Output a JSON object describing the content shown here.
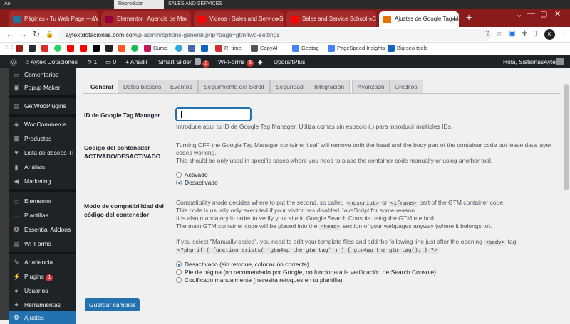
{
  "os_strip": {
    "left": "Ao",
    "middle": "Reproducir",
    "right": "SALES AND SERVICES"
  },
  "browser": {
    "tabs": [
      {
        "title": "Páginas ‹ Tu Web Page — W",
        "icon_color": "#21759b"
      },
      {
        "title": "Elementor | Agencia de Ma",
        "icon_color": "#92003b"
      },
      {
        "title": "Videos - Sales and Service S",
        "icon_color": "#ff0000"
      },
      {
        "title": "Sales and Service School - C",
        "icon_color": "#ff0000"
      },
      {
        "title": "Ajustes de Google Tag Mana",
        "icon_color": "#e37400",
        "active": true
      }
    ],
    "new_tab": "+",
    "window_controls": [
      "⌄",
      "—",
      "▢",
      "✕"
    ],
    "url_host": "aytextdotaciones.com.co",
    "url_path": "/wp-admin/options-general.php?page=gtm4wp-settings",
    "profile_initial": "K",
    "bookmarks": [
      {
        "label": "",
        "color": "#9e1c1c"
      },
      {
        "label": "",
        "color": "#2b2b2b"
      },
      {
        "label": "",
        "color": "#d93025"
      },
      {
        "label": "",
        "color": "#25d366"
      },
      {
        "label": "",
        "color": "#ff0000"
      },
      {
        "label": "",
        "color": "#ff0000"
      },
      {
        "label": "",
        "color": "#000000"
      },
      {
        "label": "",
        "color": "#222"
      },
      {
        "label": "",
        "color": "#ff5722"
      },
      {
        "label": "",
        "color": "#1db954"
      },
      {
        "label": "Curso",
        "color": "#c2185b"
      },
      {
        "label": "",
        "color": "#2ca5e0"
      },
      {
        "label": "",
        "color": "#4267b2"
      },
      {
        "label": "",
        "color": "#0a66c2"
      },
      {
        "label": "R. time",
        "color": "#d32f2f"
      },
      {
        "label": "CopyAI",
        "color": "#555"
      },
      {
        "label": "Geotag",
        "color": "#4285f4"
      },
      {
        "label": "PageSpeed Insights",
        "color": "#4285f4"
      },
      {
        "label": "Big seo tools",
        "color": "#1565c0"
      }
    ]
  },
  "adminbar": {
    "site_name": "Aytex Dotaciones",
    "updates": "1",
    "comments": "0",
    "add_new": "Añadir",
    "smart_slider": "Smart Slider",
    "yoast_count": "2",
    "wpforms_label": "WPForms",
    "wpforms_count": "5",
    "updraft": "UpdraftPlus",
    "greeting": "Hola, SistemasAytex"
  },
  "sidebar": {
    "items": [
      {
        "label": "Comentarios",
        "icon": "💬"
      },
      {
        "label": "Popup Maker",
        "icon": "▣"
      },
      {
        "label": "GetWooPlugins",
        "icon": "▤"
      },
      {
        "label": "WooCommerce",
        "icon": "◈"
      },
      {
        "label": "Productos",
        "icon": "▦"
      },
      {
        "label": "Lista de deseos TI",
        "icon": "♥"
      },
      {
        "label": "Análisis",
        "icon": "▮"
      },
      {
        "label": "Marketing",
        "icon": "📣"
      },
      {
        "label": "Elementor",
        "icon": "ⓔ"
      },
      {
        "label": "Plantillas",
        "icon": "▭"
      },
      {
        "label": "Essential Addons",
        "icon": "✪"
      },
      {
        "label": "WPForms",
        "icon": "▤"
      },
      {
        "label": "Apariencia",
        "icon": "✎"
      },
      {
        "label": "Plugins",
        "icon": "⚡",
        "badge": "1"
      },
      {
        "label": "Usuarios",
        "icon": "👤"
      },
      {
        "label": "Herramientas",
        "icon": "🔧"
      },
      {
        "label": "Ajustes",
        "icon": "⚙"
      }
    ]
  },
  "settings_tabs": [
    "General",
    "Datos básicos",
    "Eventos",
    "Seguimiento del Scroll",
    "Seguridad",
    "Integración",
    "Avanzado",
    "Créditos"
  ],
  "fields": {
    "gtm_id": {
      "label": "ID de Google Tag Manager",
      "value": "",
      "help": "Introduce aquí tu ID de Google Tag Manager. Utiliza comas sin espacio (,) para introducir múltiples IDs."
    },
    "container_on": {
      "label_line1": "Código del contenedor",
      "label_line2": "ACTIVADO/DESACTIVADO",
      "desc_line1": "Turning OFF the Google Tag Manager container itself will remove both the head and the body part of the container code but leave data layer",
      "desc_line2": "codes working.",
      "desc_line3": "This should be only used in specific cases where you need to place the container code manually or using another tool.",
      "options": [
        {
          "label": "Activado",
          "checked": false
        },
        {
          "label": "Desactivado",
          "checked": true
        }
      ]
    },
    "compat_mode": {
      "label_line1": "Modo de compatibilidad del",
      "label_line2": "código del contenedor",
      "p1_a": "Compatibility mode decides where to put the second, so called",
      "p1_code1": "<noscript>",
      "p1_or": "or",
      "p1_code2": "<iframe>",
      "p1_b": "part of the GTM container code.",
      "p2": "This code is usually only executed if your visitor has disabled JavaScript for some reason.",
      "p3": "It is also mandatory in order to verify your site in Google Search Console using the GTM method.",
      "p4_a": "The main GTM container code will be placed into the",
      "p4_code": "<head>",
      "p4_b": "section of your webpages anyway (where it belongs to).",
      "p5_a": "If you select \"Manually coded\", you need to edit your template files and add the following line just after the opening",
      "p5_code": "<body>",
      "p5_b": "tag:",
      "php_line": "<?php if ( function_exists( 'gtm4wp_the_gtm_tag' ) ) { gtm4wp_the_gtm_tag(); } ?>",
      "options": [
        {
          "label": "Desactivado (sin retoque, colocación correcta)",
          "checked": true
        },
        {
          "label": "Pie de página (no recomendado por Google, no funcionará la verificación de Search Console)",
          "checked": false
        },
        {
          "label": "Codificado manualmente (necesita retoques en tu plantilla)",
          "checked": false
        }
      ]
    }
  },
  "save_button": "Guardar cambios",
  "colors": {
    "wp_dark": "#1d2327",
    "wp_blue": "#2271b1",
    "chrome_red": "#8a1b1b",
    "badge_red": "#d63638"
  }
}
